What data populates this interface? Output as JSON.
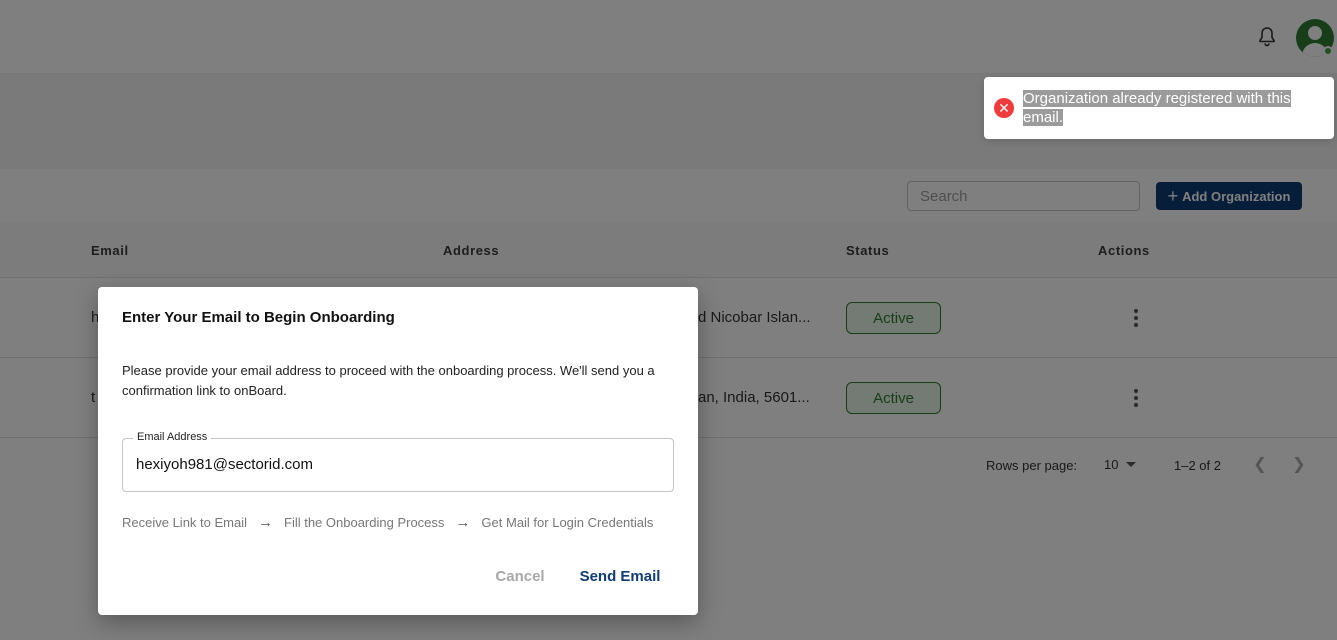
{
  "header": {
    "notification_icon": "bell-icon",
    "avatar_icon": "user-avatar-icon"
  },
  "toolbar": {
    "search_placeholder": "Search",
    "add_label": "Add Organization",
    "add_icon": "plus-icon"
  },
  "table": {
    "columns": [
      "Email",
      "Address",
      "Status",
      "Actions"
    ],
    "rows": [
      {
        "email": "h",
        "address": "d Nicobar Islan...",
        "status": "Active"
      },
      {
        "email": "t",
        "address": "an, India, 5601...",
        "status": "Active"
      }
    ]
  },
  "pagination": {
    "rows_per_page_label": "Rows per page:",
    "rows_per_page_value": "10",
    "range": "1–2 of 2"
  },
  "toast": {
    "type": "error",
    "message": "Organization already registered with this email."
  },
  "dialog": {
    "title": "Enter Your Email to Begin Onboarding",
    "description": "Please provide your email address to proceed with the onboarding process. We'll send you a confirmation link to onBoard.",
    "email_label": "Email Address",
    "email_value": "hexiyoh981@sectorid.com",
    "steps": [
      "Receive Link to Email",
      "Fill the Onboarding Process",
      "Get Mail for Login Credentials"
    ],
    "cancel_label": "Cancel",
    "send_label": "Send Email"
  },
  "colors": {
    "primary": "#0f3d74",
    "active": "#2e7d32",
    "error": "#ef3b3b"
  }
}
